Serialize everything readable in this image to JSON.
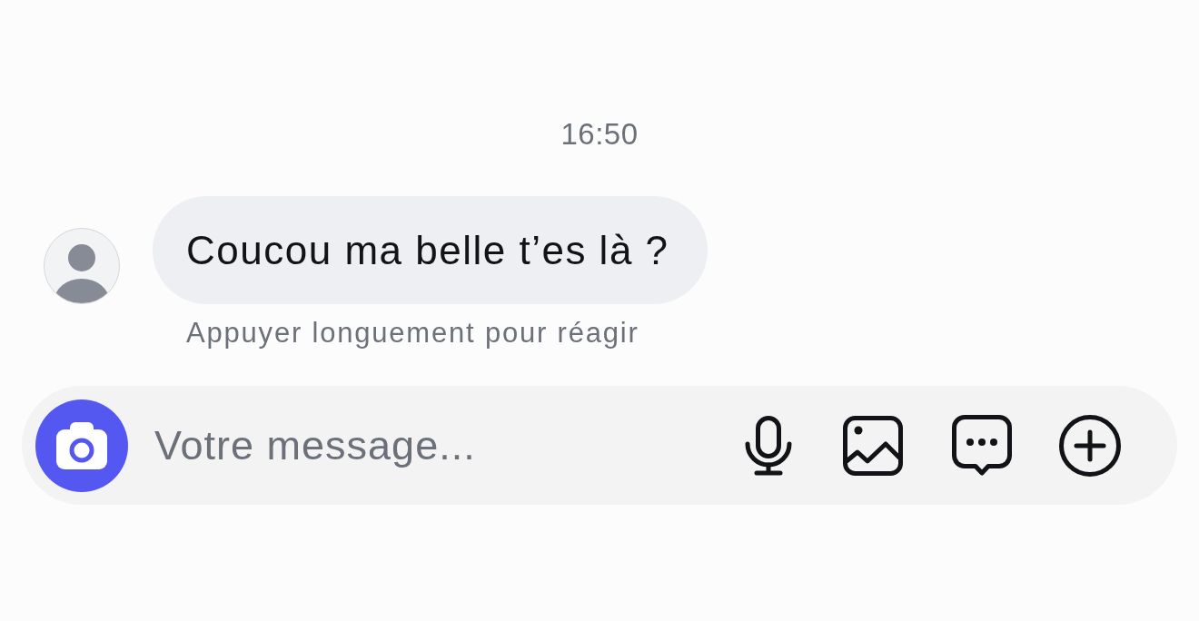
{
  "timestamp": "16:50",
  "messages": [
    {
      "text": "Coucou ma belle t’es là ?",
      "hint": "Appuyer longuement pour réagir"
    }
  ],
  "composer": {
    "placeholder": "Votre message..."
  }
}
